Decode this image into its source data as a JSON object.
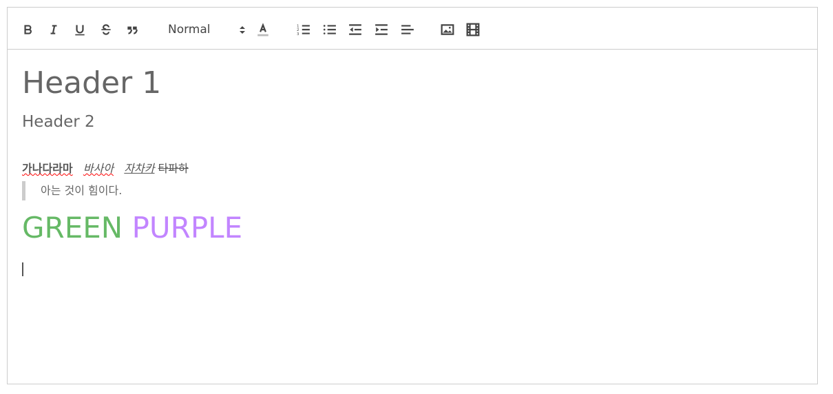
{
  "toolbar": {
    "buttons": [
      "bold",
      "italic",
      "underline",
      "strike",
      "blockquote",
      "header-picker",
      "color",
      "ordered-list",
      "bullet-list",
      "outdent",
      "indent",
      "align",
      "image",
      "video"
    ],
    "header_picker_value": "Normal"
  },
  "content": {
    "h1": "Header 1",
    "h2": "Header 2",
    "bold_text": "가나다라마",
    "italic_text": "바사아",
    "underline_text": "자차카",
    "strike_text": "타파하",
    "blockquote": "아는 것이 힘이다.",
    "green_text": "GREEN",
    "purple_text": "PURPLE",
    "colors": {
      "green": "#66b966",
      "purple": "#c285ff"
    }
  }
}
